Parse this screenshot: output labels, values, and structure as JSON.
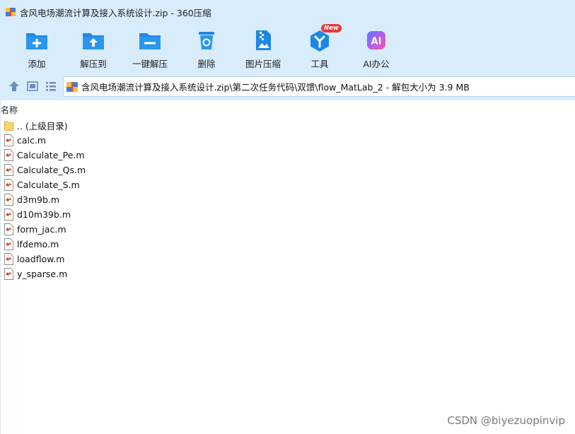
{
  "window": {
    "title": "含风电场潮流计算及接入系统设计.zip - 360压缩"
  },
  "toolbar": {
    "items": [
      {
        "label": "添加",
        "icon": "add-icon"
      },
      {
        "label": "解压到",
        "icon": "extract-to-icon"
      },
      {
        "label": "一键解压",
        "icon": "one-click-extract-icon"
      },
      {
        "label": "删除",
        "icon": "delete-icon"
      },
      {
        "label": "图片压缩",
        "icon": "image-compress-icon"
      },
      {
        "label": "工具",
        "icon": "tools-icon",
        "badge": "New"
      },
      {
        "label": "AI办公",
        "icon": "ai-office-icon",
        "icon_text": "AI"
      }
    ]
  },
  "address": {
    "path": "含风电场潮流计算及接入系统设计.zip\\第二次任务代码\\双馈\\flow_MatLab_2 - 解包大小为 3.9 MB"
  },
  "filelist": {
    "column_name": "名称",
    "items": [
      {
        "name": ".. (上级目录)",
        "type": "folder"
      },
      {
        "name": "calc.m",
        "type": "m-file"
      },
      {
        "name": "Calculate_Pe.m",
        "type": "m-file"
      },
      {
        "name": "Calculate_Qs.m",
        "type": "m-file"
      },
      {
        "name": "Calculate_S.m",
        "type": "m-file"
      },
      {
        "name": "d3m9b.m",
        "type": "m-file"
      },
      {
        "name": "d10m39b.m",
        "type": "m-file"
      },
      {
        "name": "form_jac.m",
        "type": "m-file"
      },
      {
        "name": "lfdemo.m",
        "type": "m-file"
      },
      {
        "name": "loadflow.m",
        "type": "m-file"
      },
      {
        "name": "y_sparse.m",
        "type": "m-file"
      }
    ]
  },
  "watermark": "CSDN @biyezuopinvip",
  "colors": {
    "toolbar_bg": "#d9ecfb",
    "icon_blue": "#1e88e5",
    "badge_red": "#e83a3a"
  }
}
